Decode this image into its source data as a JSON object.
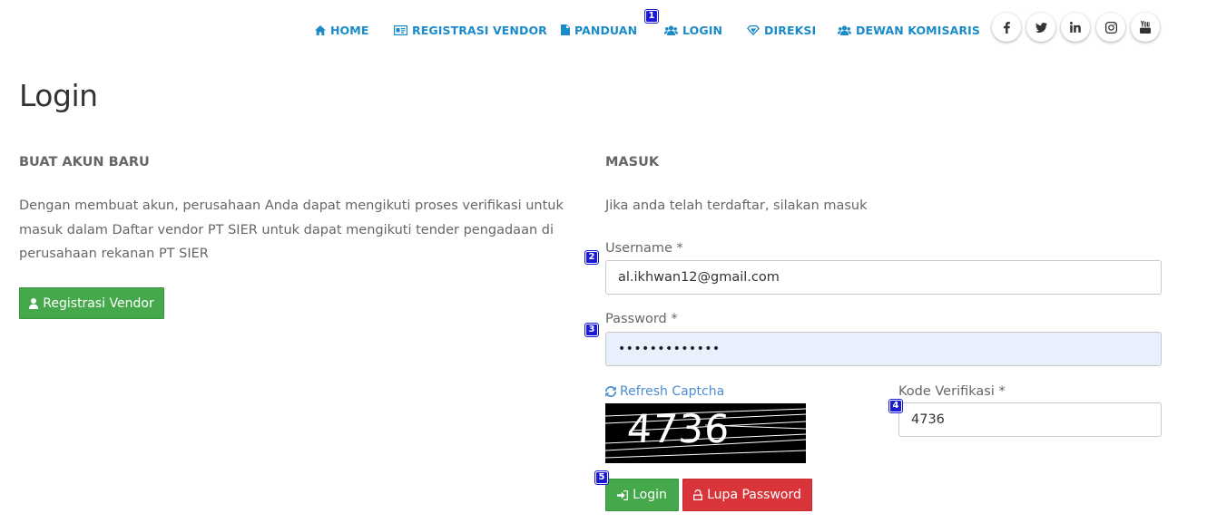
{
  "nav": {
    "home": "HOME",
    "registrasi_vendor": "REGISTRASI VENDOR",
    "panduan": "PANDUAN",
    "login": "LOGIN",
    "direksi": "DIREKSI",
    "dewan_komisaris": "DEWAN KOMISARIS"
  },
  "social_icons": [
    "facebook-icon",
    "twitter-icon",
    "linkedin-icon",
    "instagram-icon",
    "youtube-icon"
  ],
  "badges": [
    "1",
    "2",
    "3",
    "4",
    "5"
  ],
  "page": {
    "title": "Login"
  },
  "register": {
    "heading": "BUAT AKUN BARU",
    "line1": "Dengan membuat akun, perusahaan Anda dapat mengikuti proses verifikasi untuk",
    "line2": "masuk dalam Daftar vendor PT SIER untuk dapat mengikuti tender pengadaan di",
    "line3": "perusahaan rekanan PT SIER",
    "button": "Registrasi Vendor"
  },
  "login": {
    "heading": "MASUK",
    "description": "Jika anda telah terdaftar, silakan masuk",
    "username_label": "Username *",
    "username_value": "al.ikhwan12@gmail.com",
    "password_label": "Password *",
    "password_value": "•••••••••••••",
    "refresh_captcha": "Refresh Captcha",
    "captcha_text": "4736",
    "kode_label": "Kode Verifikasi *",
    "kode_value": "4736",
    "login_button": "Login",
    "forgot_button": "Lupa Password"
  },
  "colors": {
    "nav_link": "#1a8bc8",
    "green_button": "#45a94b",
    "red_button": "#d9343a",
    "autofill_bg": "#e8f0fe",
    "badge": "#1b1bd6"
  }
}
